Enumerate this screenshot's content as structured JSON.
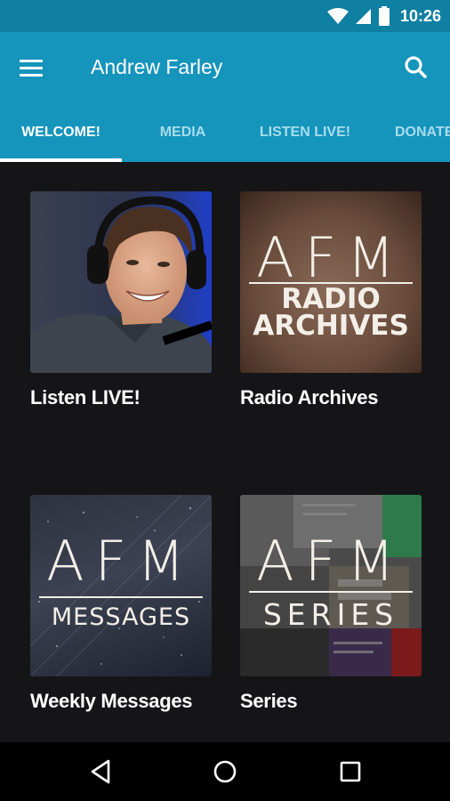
{
  "status_bar": {
    "time": "10:26"
  },
  "app_bar": {
    "title": "Andrew Farley"
  },
  "tabs": [
    {
      "label": "WELCOME!",
      "active": true
    },
    {
      "label": "MEDIA",
      "active": false
    },
    {
      "label": "LISTEN LIVE!",
      "active": false
    },
    {
      "label": "DONATE",
      "active": false
    }
  ],
  "tiles": [
    {
      "label": "Listen LIVE!"
    },
    {
      "label": "Radio Archives",
      "logo_main": "AFM",
      "logo_sub": "RADIO ARCHIVES",
      "logo_sub_line1": "RADIO",
      "logo_sub_line2": "ARCHIVES"
    },
    {
      "label": "Weekly Messages",
      "logo_main": "AFM",
      "logo_sub": "MESSAGES"
    },
    {
      "label": "Series",
      "logo_main": "AFM",
      "logo_sub": "SERIES"
    }
  ],
  "colors": {
    "app_bar": "#1594bc",
    "status_bar": "#0f7fa2",
    "background": "#151518",
    "tab_inactive": "#a8dcec"
  }
}
